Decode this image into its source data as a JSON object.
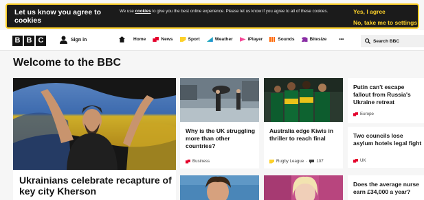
{
  "cookie": {
    "title": "Let us know you agree to cookies",
    "text_before": "We use ",
    "text_link": "cookies",
    "text_after": " to give you the best online experience. Please let us know if you agree to all of these cookies.",
    "yes_label": "Yes, I agree",
    "no_label": "No, take me to settings",
    "accent_color": "#fdd12a"
  },
  "nav": {
    "brand": [
      "B",
      "B",
      "C"
    ],
    "signin_label": "Sign in",
    "items": [
      {
        "label": "Home",
        "icon": "home-icon",
        "color": "#141414"
      },
      {
        "label": "News",
        "icon": "news-icon",
        "color": "#e4002b"
      },
      {
        "label": "Sport",
        "icon": "sport-icon",
        "color": "#fdd12a"
      },
      {
        "label": "Weather",
        "icon": "weather-icon",
        "color": "#1782d6"
      },
      {
        "label": "iPlayer",
        "icon": "iplayer-icon",
        "color": "#f54997"
      },
      {
        "label": "Sounds",
        "icon": "sounds-icon",
        "color": "#ff6600"
      },
      {
        "label": "Bitesize",
        "icon": "bitesize-icon",
        "color": "#8a2ea5"
      }
    ],
    "more_label": "•••",
    "search_label": "Search BBC"
  },
  "page": {
    "heading": "Welcome to the BBC"
  },
  "stories": {
    "lead": {
      "title": "Ukrainians celebrate recapture of key city Kherson"
    },
    "card1": {
      "title": "Why is the UK struggling more than other countries?",
      "tag": "Business",
      "tag_color": "#e4002b"
    },
    "card2": {
      "title": "Australia edge Kiwis in thriller to reach final",
      "tag": "Rugby League",
      "comments": "107",
      "tag_color": "#fdd12a"
    },
    "side1": {
      "title": "Putin can't escape fallout from Russia's Ukraine retreat",
      "tag": "Europe",
      "tag_color": "#e4002b"
    },
    "side2": {
      "title": "Two councils lose asylum hotels legal fight",
      "tag": "UK",
      "tag_color": "#e4002b"
    },
    "side3": {
      "title": "Does the average nurse earn £34,000 a year?"
    }
  }
}
